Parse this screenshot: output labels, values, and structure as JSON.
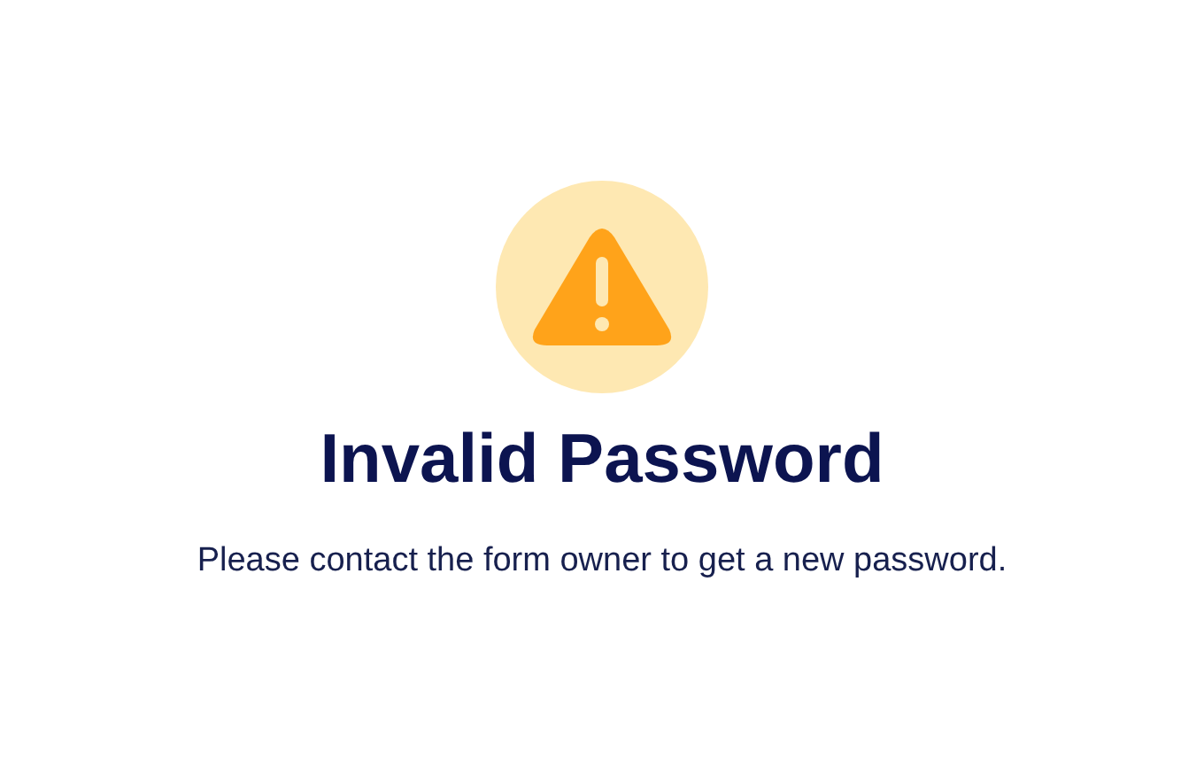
{
  "title": "Invalid Password",
  "message": "Please contact the form owner to get a new password."
}
